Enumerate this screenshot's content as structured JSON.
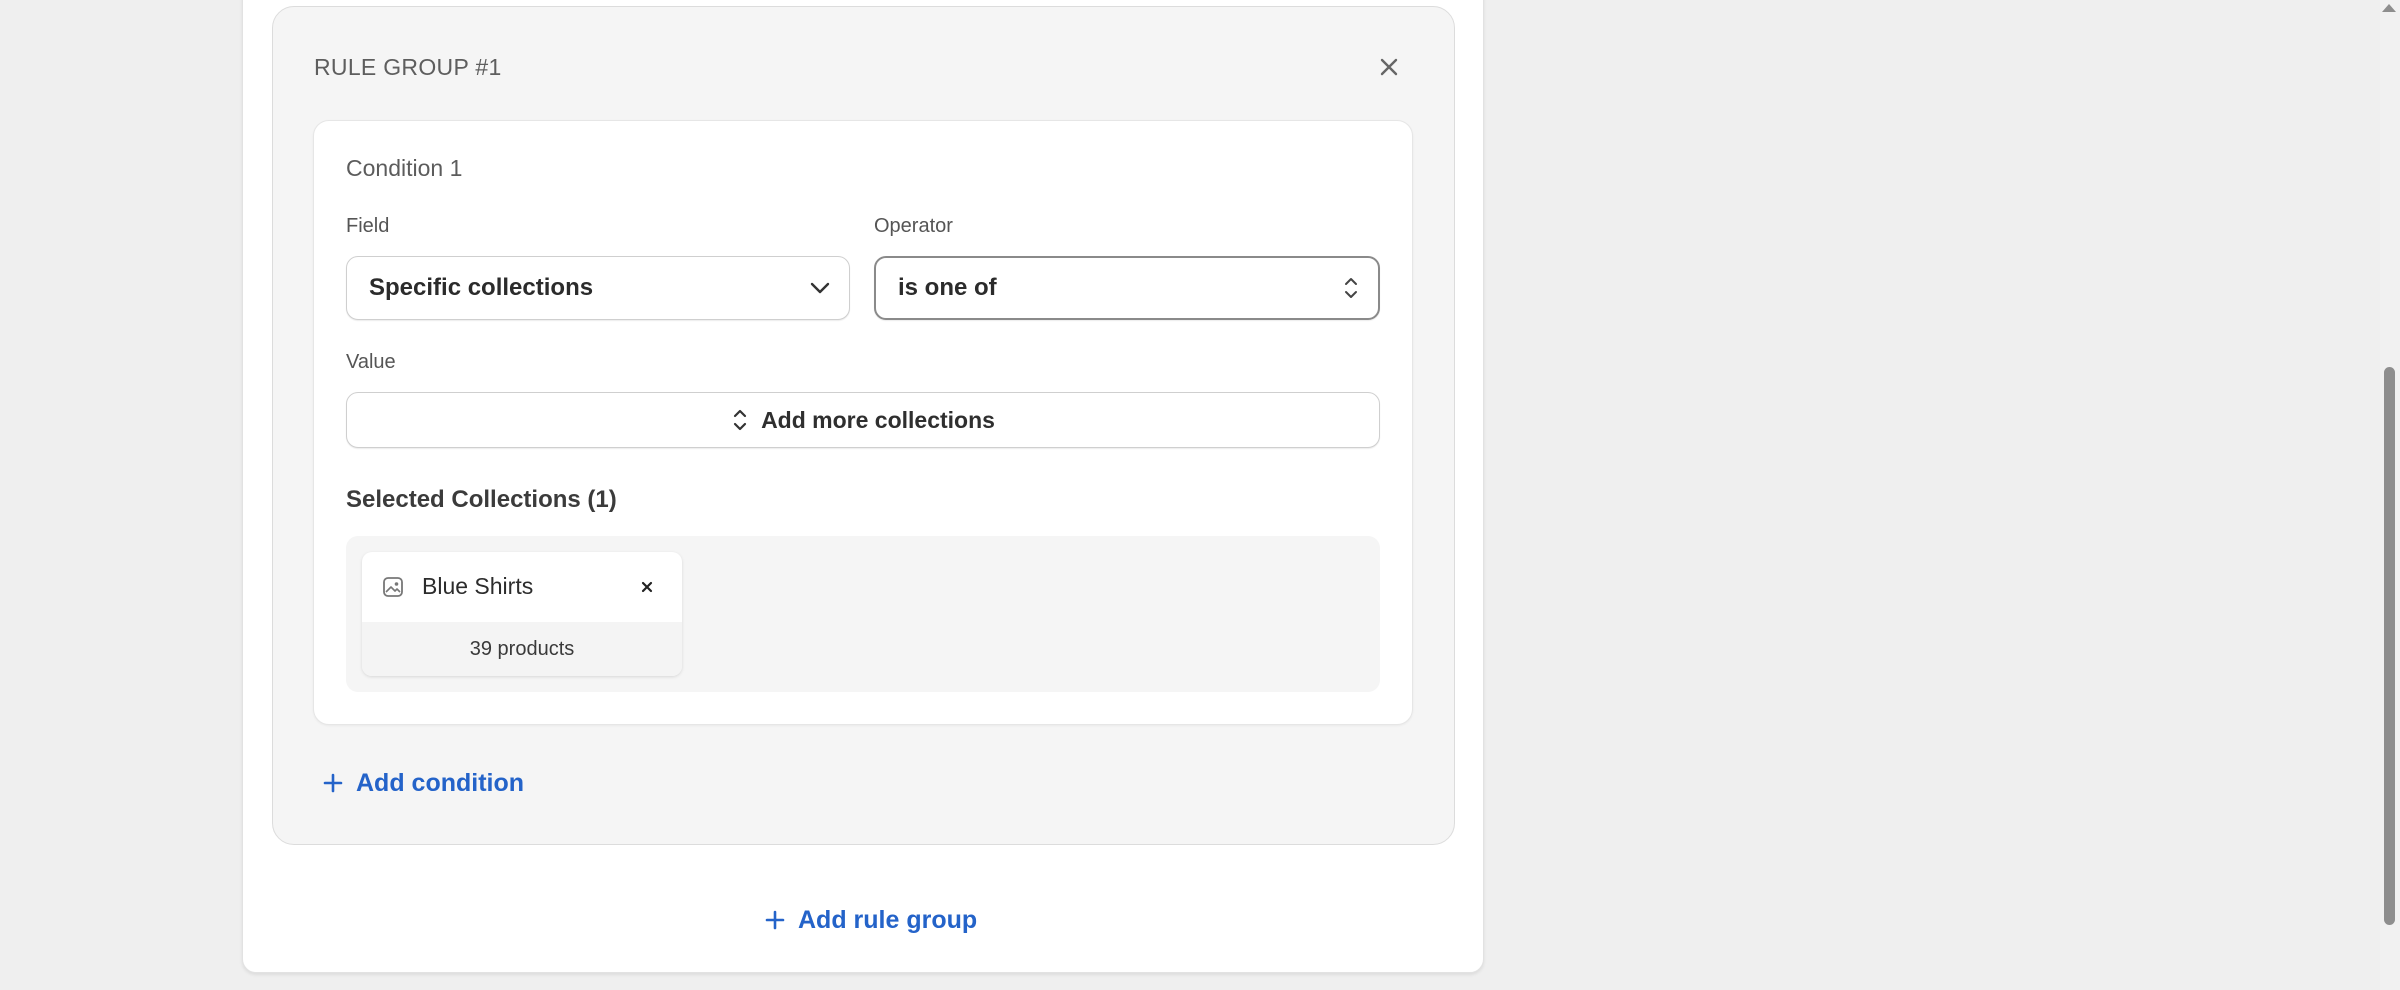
{
  "rule_group": {
    "title": "RULE GROUP #1"
  },
  "condition": {
    "title": "Condition 1",
    "field_label": "Field",
    "field_value": "Specific collections",
    "operator_label": "Operator",
    "operator_value": "is one of",
    "value_label": "Value",
    "add_collections_label": "Add more collections",
    "selected_heading": "Selected Collections (1)",
    "selected": [
      {
        "name": "Blue Shirts",
        "count": "39 products"
      }
    ]
  },
  "actions": {
    "add_condition": "Add condition",
    "add_rule_group": "Add rule group"
  },
  "icons": {
    "close": "close-icon",
    "chevron": "chevron-down-icon",
    "updown": "updown-chevron-icon",
    "image": "image-icon",
    "plus": "plus-icon"
  },
  "colors": {
    "accent": "#2463c9",
    "background": "#efefef"
  }
}
